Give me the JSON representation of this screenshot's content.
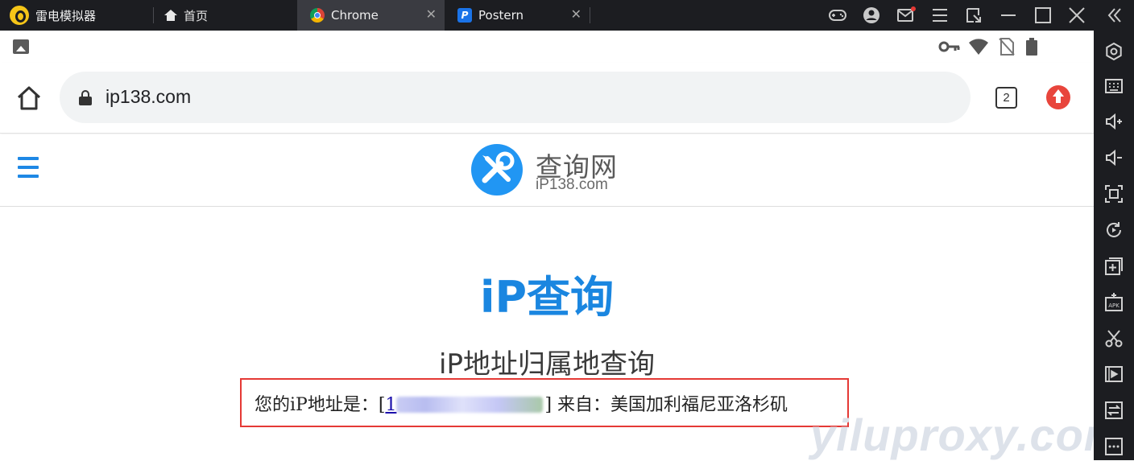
{
  "emulator": {
    "app_name": "雷电模拟器",
    "home_tab": "首页",
    "tabs": [
      {
        "label": "Chrome",
        "active": true,
        "icon": "chrome-icon"
      },
      {
        "label": "Postern",
        "active": false,
        "icon": "postern-icon"
      }
    ],
    "window_icons": [
      "gamepad-icon",
      "user-avatar-icon",
      "mail-icon",
      "menu-icon",
      "restore-icon",
      "minimize-icon",
      "maximize-icon",
      "close-icon",
      "collapse-icon"
    ],
    "sidebar_tools": [
      "settings-icon",
      "keyboard-icon",
      "volume-up-icon",
      "volume-down-icon",
      "fullscreen-icon",
      "rotate-icon",
      "add-window-icon",
      "apk-install-icon",
      "scissors-icon",
      "record-video-icon",
      "sync-icon",
      "more-icon"
    ]
  },
  "status_bar": {
    "left_icon": "photo-icon",
    "right_icons": [
      "key-icon",
      "wifi-icon",
      "no-sim-icon",
      "battery-icon"
    ]
  },
  "browser": {
    "url": "ip138.com",
    "tab_count": "2",
    "update_button": "update-icon"
  },
  "site": {
    "logo_title": "查询网",
    "logo_sub": "iP138.com",
    "main_title": "iP查询",
    "subtitle": "iP地址归属地查询",
    "ip_prefix": "您的iP地址是：[",
    "ip_link_visible": "1",
    "ip_suffix": "] 来自：美国加利福尼亚洛杉矶"
  },
  "watermark": "yiluproxy.com",
  "colors": {
    "emulator_bg": "#1c1d21",
    "site_blue": "#1a86e0",
    "highlight_border": "#e53935",
    "update_red": "#e8453c"
  }
}
